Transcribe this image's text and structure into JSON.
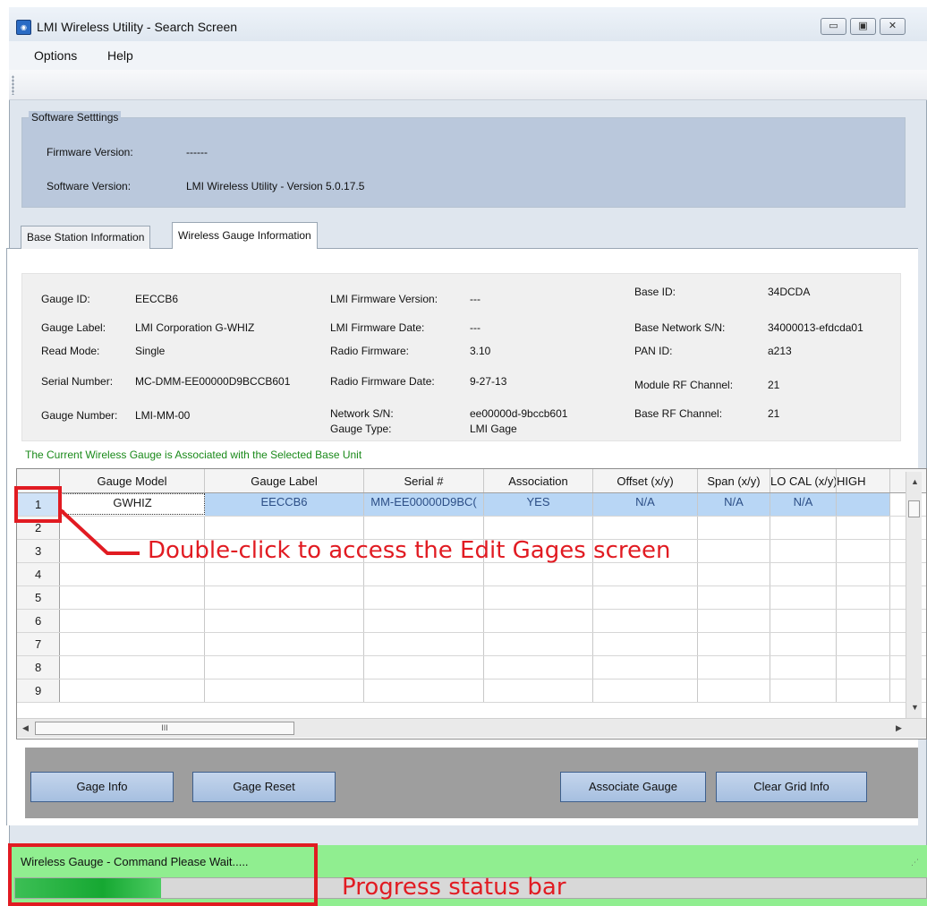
{
  "window": {
    "title": "LMI Wireless Utility - Search Screen",
    "minimize_glyph": "▭",
    "maximize_glyph": "▣",
    "close_glyph": "✕"
  },
  "menu": {
    "items": [
      "Options",
      "Help"
    ]
  },
  "software_settings": {
    "legend": "Software Setttings",
    "firmware_label": "Firmware Version:",
    "firmware_value": "------",
    "software_label": "Software Version:",
    "software_value": "LMI Wireless Utility - Version 5.0.17.5"
  },
  "tabs": [
    {
      "label": "Base Station Information",
      "active": false
    },
    {
      "label": "Wireless Gauge Information",
      "active": true
    }
  ],
  "gauge_info": {
    "gauge_id_label": "Gauge ID:",
    "gauge_id": "EECCB6",
    "gauge_label_label": "Gauge Label:",
    "gauge_label": "LMI Corporation G-WHIZ",
    "read_mode_label": "Read Mode:",
    "read_mode": "Single",
    "serial_label": "Serial Number:",
    "serial": "MC-DMM-EE00000D9BCCB601",
    "gauge_number_label": "Gauge Number:",
    "gauge_number": "LMI-MM-00",
    "lmi_fw_version_label": "LMI Firmware Version:",
    "lmi_fw_version": "---",
    "lmi_fw_date_label": "LMI Firmware Date:",
    "lmi_fw_date": "---",
    "radio_fw_label": "Radio Firmware:",
    "radio_fw": "3.10",
    "radio_fw_date_label": "Radio Firmware Date:",
    "radio_fw_date": "9-27-13",
    "network_sn_label": "Network S/N:",
    "network_sn": "ee00000d-9bccb601",
    "gauge_type_label": "Gauge Type:",
    "gauge_type": "LMI Gage",
    "base_id_label": "Base ID:",
    "base_id": "34DCDA",
    "base_network_sn_label": "Base Network S/N:",
    "base_network_sn": "34000013-efdcda01",
    "pan_id_label": "PAN ID:",
    "pan_id": "a213",
    "module_rf_label": "Module RF Channel:",
    "module_rf": "21",
    "base_rf_label": "Base RF Channel:",
    "base_rf": "21"
  },
  "association_message": "The Current Wireless Gauge is Associated with the Selected Base Unit",
  "grid": {
    "columns": [
      "Gauge Model",
      "Gauge Label",
      "Serial #",
      "Association",
      "Offset (x/y)",
      "Span (x/y)",
      "LO CAL (x/y)",
      "HIGH"
    ],
    "rows": [
      {
        "num": "1",
        "cells": [
          "GWHIZ",
          "EECCB6",
          "MM-EE00000D9BC(",
          "YES",
          "N/A",
          "N/A",
          "N/A",
          ""
        ]
      },
      {
        "num": "2",
        "cells": [
          "",
          "",
          "",
          "",
          "",
          "",
          "",
          ""
        ]
      },
      {
        "num": "3",
        "cells": [
          "",
          "",
          "",
          "",
          "",
          "",
          "",
          ""
        ]
      },
      {
        "num": "4",
        "cells": [
          "",
          "",
          "",
          "",
          "",
          "",
          "",
          ""
        ]
      },
      {
        "num": "5",
        "cells": [
          "",
          "",
          "",
          "",
          "",
          "",
          "",
          ""
        ]
      },
      {
        "num": "6",
        "cells": [
          "",
          "",
          "",
          "",
          "",
          "",
          "",
          ""
        ]
      },
      {
        "num": "7",
        "cells": [
          "",
          "",
          "",
          "",
          "",
          "",
          "",
          ""
        ]
      },
      {
        "num": "8",
        "cells": [
          "",
          "",
          "",
          "",
          "",
          "",
          "",
          ""
        ]
      },
      {
        "num": "9",
        "cells": [
          "",
          "",
          "",
          "",
          "",
          "",
          "",
          ""
        ]
      }
    ],
    "hscroll_thumb_glyph": "III"
  },
  "buttons": {
    "gage_info": "Gage Info",
    "gage_reset": "Gage Reset",
    "associate_gauge": "Associate Gauge",
    "clear_grid_info": "Clear Grid Info"
  },
  "status": {
    "text": "Wireless Gauge - Command Please Wait.....",
    "progress_percent": 16
  },
  "annotations": {
    "edit_gages": "Double-click to access the Edit Gages screen",
    "progress_bar": "Progress status bar"
  },
  "colors": {
    "annotation_red": "#e11b22",
    "status_green": "#90ee90",
    "progress_green": "#16a832",
    "selected_row": "#b8d6f5",
    "panel_blue": "#bac8dc"
  }
}
